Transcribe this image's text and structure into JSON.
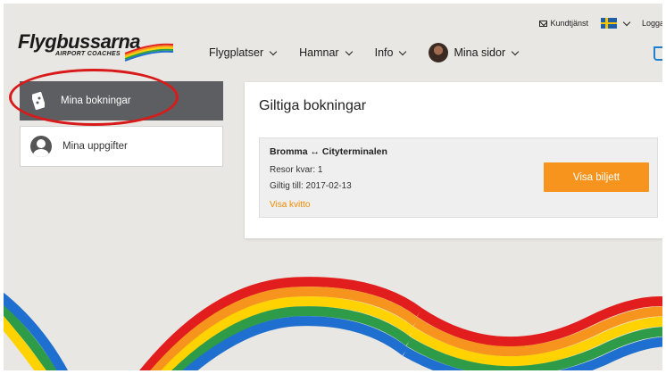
{
  "header": {
    "logo_text": "Flygbussarna",
    "logo_sub": "AIRPORT COACHES",
    "utility": {
      "kundtjanst_label": "Kundtjänst",
      "login_label": "Logga"
    },
    "nav": [
      {
        "label": "Flygplatser"
      },
      {
        "label": "Hamnar"
      },
      {
        "label": "Info"
      },
      {
        "label": "Mina sidor"
      }
    ]
  },
  "sidebar": {
    "items": [
      {
        "label": "Mina bokningar",
        "icon": "ticket-icon",
        "active": true
      },
      {
        "label": "Mina uppgifter",
        "icon": "user-icon",
        "active": false
      }
    ]
  },
  "main": {
    "title": "Giltiga bokningar",
    "booking": {
      "route": "Bromma ↔ Cityterminalen",
      "trips_left": "Resor kvar: 1",
      "valid_until": "Giltig till: 2017-02-13",
      "receipt_link": "Visa kvitto",
      "button_label": "Visa biljett"
    }
  },
  "colors": {
    "accent": "#f7941d",
    "sidebar_active": "#5c5e62",
    "annotation": "#d81a1a",
    "cart": "#1e7fd0"
  }
}
